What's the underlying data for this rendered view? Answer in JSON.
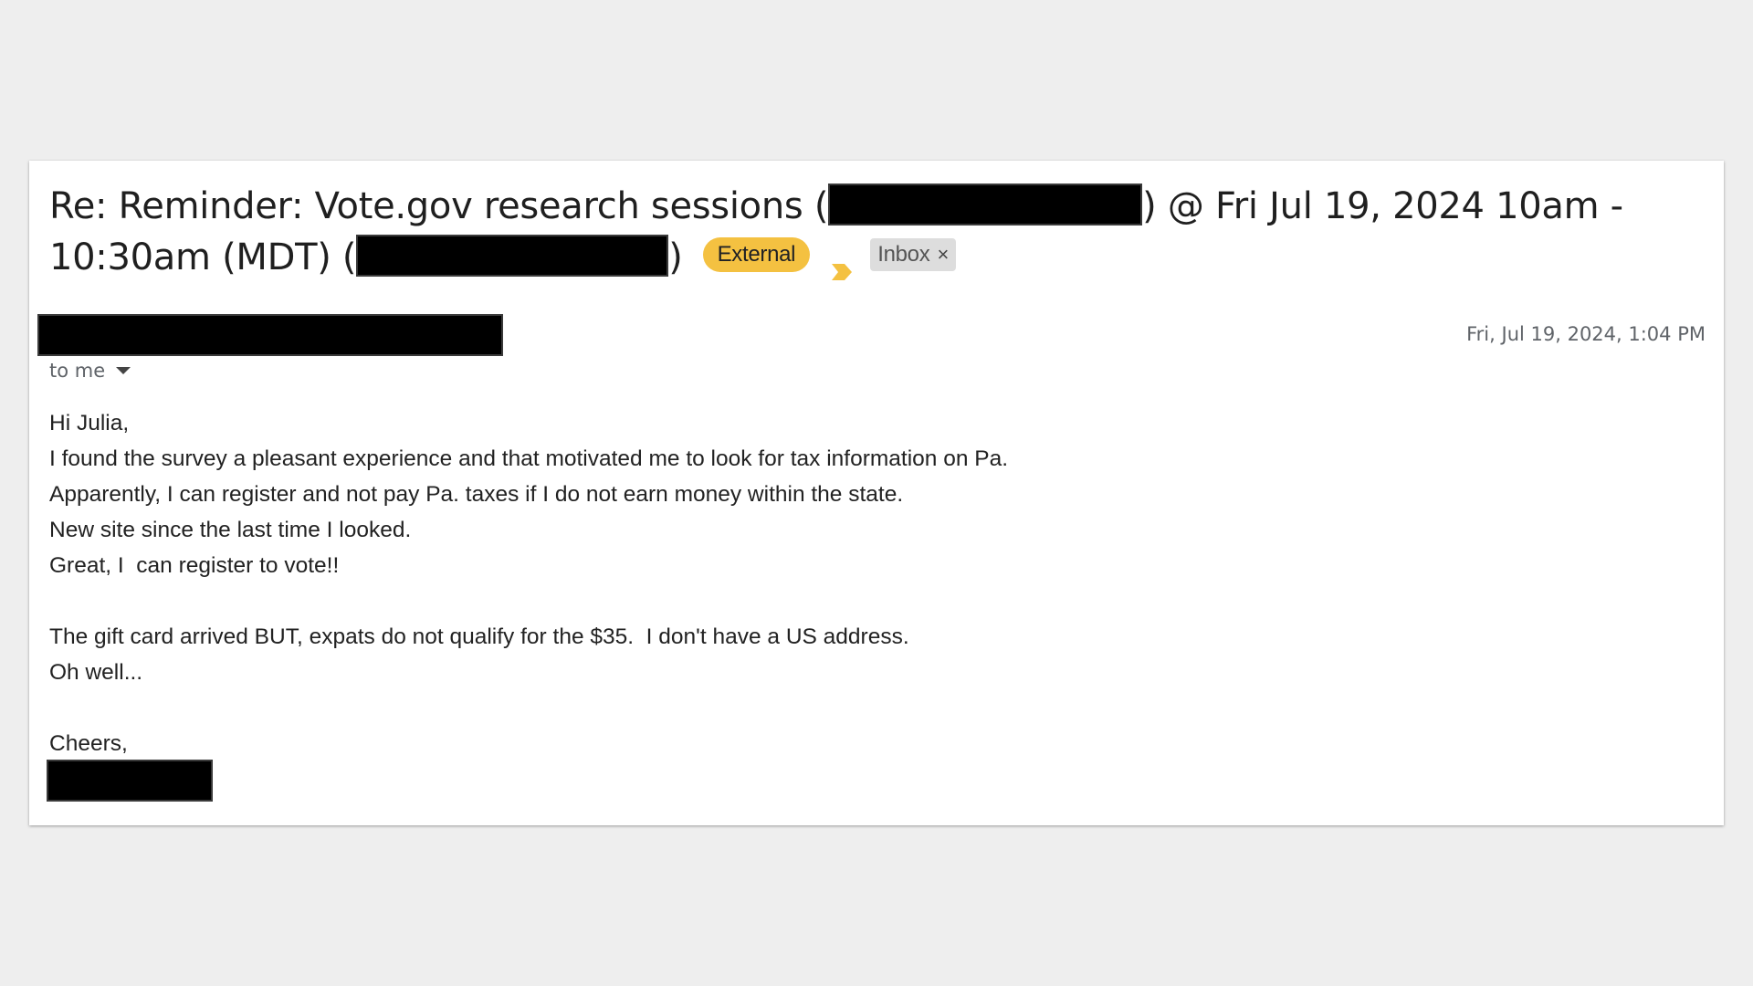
{
  "email": {
    "subject_part1": "Re: Reminder: Vote.gov research sessions (",
    "subject_part2": ") @ Fri Jul 19, 2024 10am -",
    "subject_part3": "10:30am (MDT) (",
    "subject_part4": ")",
    "labels": {
      "external": "External",
      "inbox": "Inbox",
      "inbox_remove": "×"
    },
    "date": "Fri, Jul 19, 2024, 1:04 PM",
    "recipient": "to me",
    "body_lines": [
      "Hi Julia,",
      "I found the survey a pleasant experience and that motivated me to look for tax information on Pa.",
      "Apparently, I can register and not pay Pa. taxes if I do not earn money within the state.",
      "New site since the last time I looked.",
      "Great, I  can register to vote!!",
      "",
      "The gift card arrived BUT, expats do not qualify for the $35.  I don't have a US address.",
      "Oh well...",
      "",
      "Cheers,"
    ]
  },
  "colors": {
    "background": "#eeeeee",
    "card": "#ffffff",
    "external_label": "#f4c141",
    "importance_marker": "#f4c141",
    "inbox_label": "#dddddd",
    "redaction": "#000000"
  },
  "icons": {
    "importance": "importance-marker-icon",
    "remove_label": "close-icon",
    "expand_recipients": "chevron-down-icon"
  }
}
